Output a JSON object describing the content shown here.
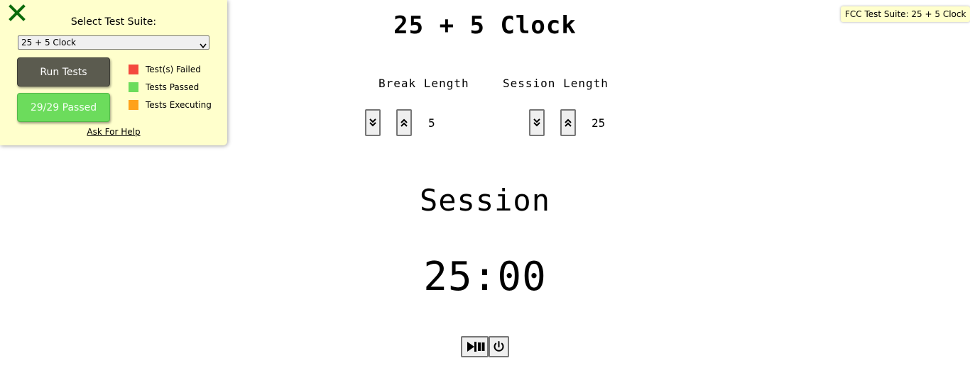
{
  "test_panel": {
    "select_label": "Select Test Suite:",
    "selected_suite": "25 + 5 Clock",
    "run_button": "Run Tests",
    "result_button": "29/29 Passed",
    "legend": [
      {
        "label": "Test(s) Failed",
        "color": "#f4493e"
      },
      {
        "label": "Tests Passed",
        "color": "#6cdc5c"
      },
      {
        "label": "Tests Executing",
        "color": "#ffa21a"
      }
    ],
    "help_link": "Ask For Help",
    "close_icon": "close-x-icon",
    "tooltip": "FCC Test Suite: 25 + 5 Clock"
  },
  "clock": {
    "title": "25 + 5 Clock",
    "break_label": "Break Length",
    "break_value": "5",
    "session_label": "Session Length",
    "session_value": "25",
    "timer_label": "Session",
    "time_left": "25:00",
    "icons": {
      "decrement": "double-chevron-down-icon",
      "increment": "double-chevron-up-icon",
      "start_stop": "play-pause-icon",
      "reset": "power-icon"
    }
  }
}
